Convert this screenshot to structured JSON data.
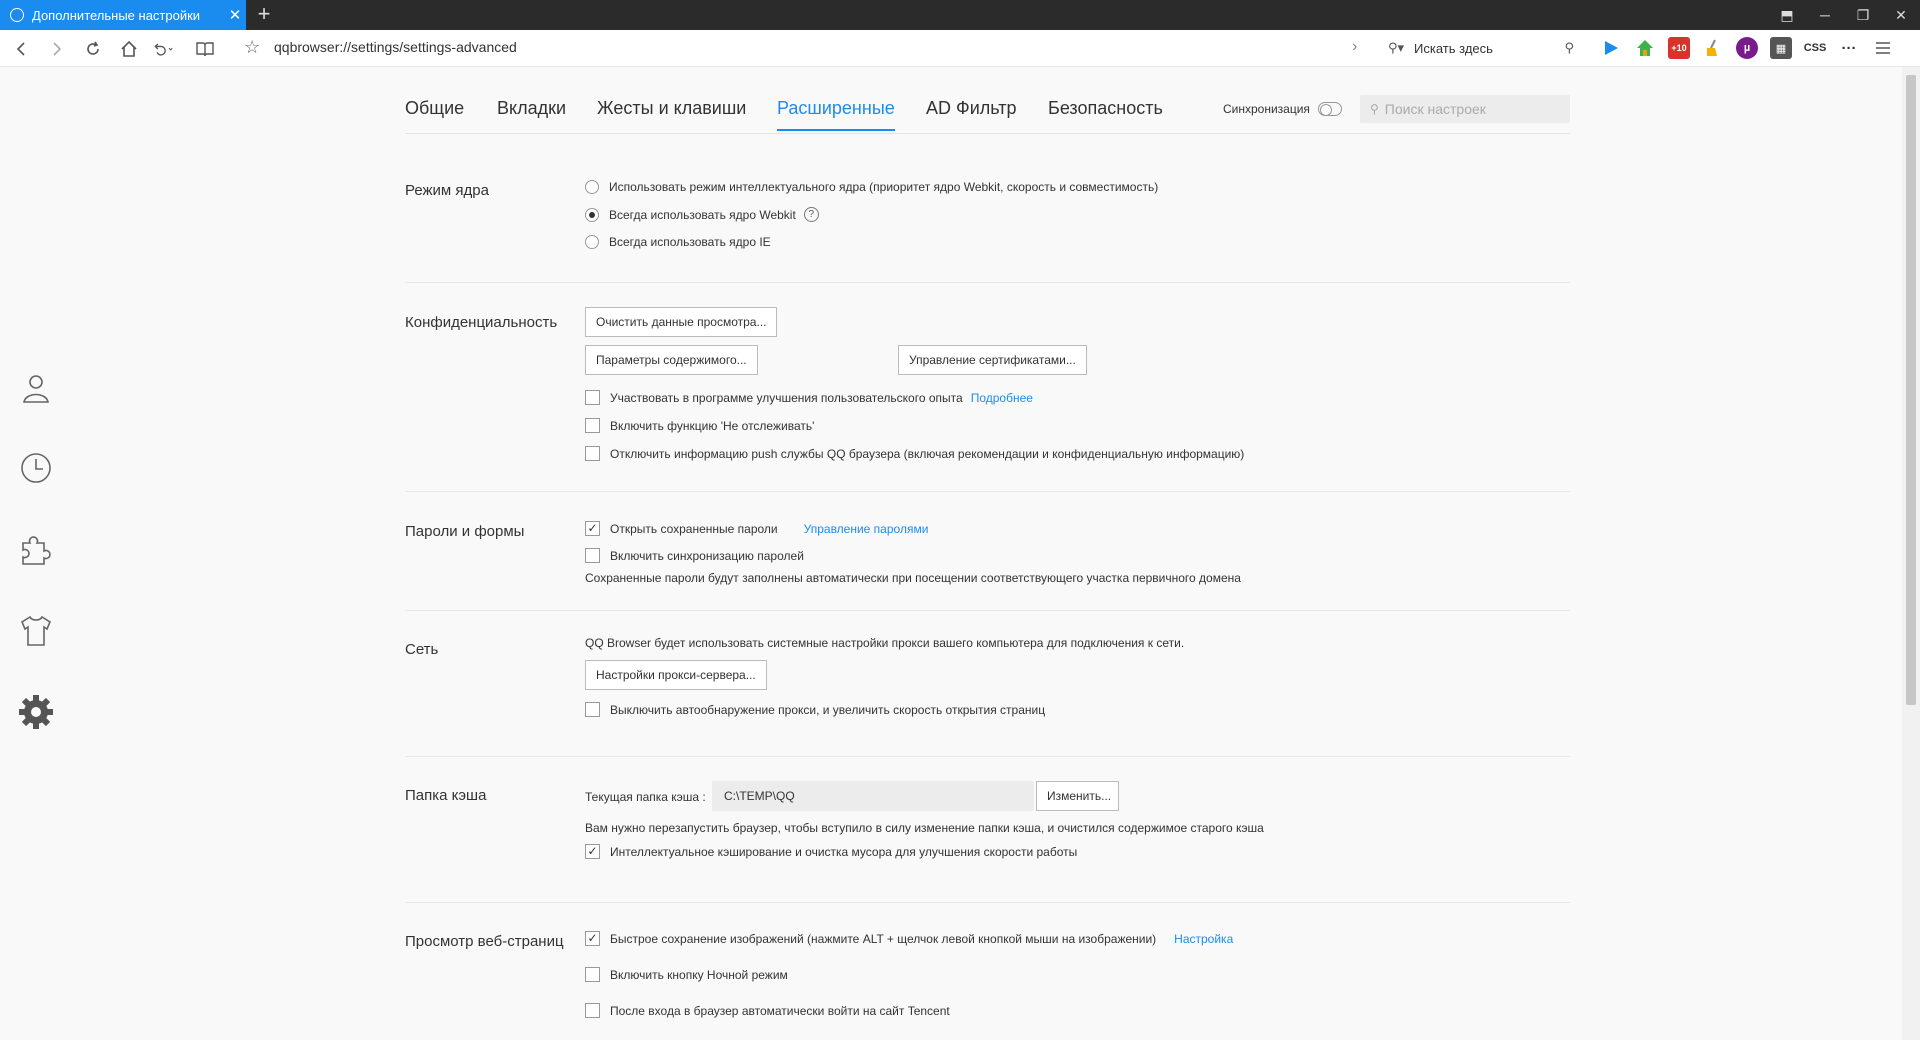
{
  "tab": {
    "title": "Дополнительные настройки",
    "close": "✕",
    "new": "+"
  },
  "window_controls": {
    "clip": "⬒",
    "minimize": "─",
    "restore": "❐",
    "close": "✕"
  },
  "address": {
    "url": "qqbrowser://settings/settings-advanced",
    "search_placeholder": "Искать здесь",
    "css_label": "CSS",
    "more": "···"
  },
  "settings_nav": {
    "tabs": [
      "Общие",
      "Вкладки",
      "Жесты и клавиши",
      "Расширенные",
      "AD Фильтр",
      "Безопасность"
    ],
    "active": "Расширенные",
    "sync_label": "Синхронизация",
    "search_placeholder": "Поиск настроек"
  },
  "kernel": {
    "title": "Режим ядра",
    "options": [
      "Использовать режим интеллектуального ядра (приоритет ядро Webkit, скорость и совместимость)",
      "Всегда использовать ядро Webkit",
      "Всегда использовать ядро IE"
    ],
    "selected_index": 1
  },
  "privacy": {
    "title": "Конфиденциальность",
    "clear_button": "Очистить данные просмотра...",
    "content_button": "Параметры содержимого...",
    "cert_button": "Управление сертификатами...",
    "checks": [
      {
        "label": "Участвовать в программе улучшения пользовательского опыта",
        "link": "Подробнее",
        "checked": false
      },
      {
        "label": "Включить функцию 'Не отслеживать'",
        "checked": false
      },
      {
        "label": "Отключить информацию push службы QQ браузера (включая рекомендации и конфиденциальную информацию)",
        "checked": false
      }
    ]
  },
  "passwords": {
    "title": "Пароли и формы",
    "checks": [
      {
        "label": "Открыть сохраненные пароли",
        "link": "Управление паролями",
        "checked": true
      },
      {
        "label": "Включить синхронизацию паролей",
        "checked": false
      }
    ],
    "note": "Сохраненные пароли будут заполнены автоматически при посещении соответствующего участка первичного домена"
  },
  "network": {
    "title": "Сеть",
    "note": "QQ Browser будет использовать системные настройки прокси вашего компьютера для подключения к сети.",
    "proxy_button": "Настройки прокси-сервера...",
    "check": {
      "label": "Выключить автообнаружение прокси, и увеличить скорость открытия страниц",
      "checked": false
    }
  },
  "cache": {
    "title": "Папка кэша",
    "label": "Текущая папка кэша :",
    "path": "C:\\TEMP\\QQ",
    "change_button": "Изменить...",
    "note": "Вам нужно перезапустить браузер, чтобы вступило в силу изменение папки кэша, и очистился содержимое старого кэша",
    "check": {
      "label": "Интеллектуальное кэширование и очистка мусора для улучшения скорости работы",
      "checked": true
    }
  },
  "browsing": {
    "title": "Просмотр веб-страниц",
    "checks": [
      {
        "label": "Быстрое сохранение изображений (нажмите ALT + щелчок левой кнопкой мыши на изображении)",
        "link": "Настройка",
        "checked": true
      },
      {
        "label": "Включить кнопку Ночной режим",
        "checked": false
      },
      {
        "label": "После входа в браузер автоматически войти на сайт Tencent",
        "checked": false
      }
    ]
  },
  "check_mark": "✓",
  "help_mark": "?"
}
